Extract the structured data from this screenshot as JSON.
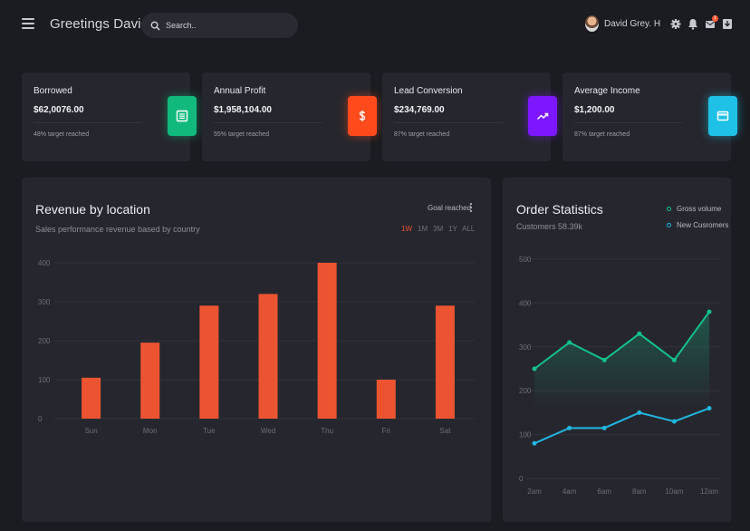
{
  "topbar": {
    "greeting": "Greetings David!",
    "search_placeholder": "Search..",
    "user_name": "David Grey. H",
    "notification_count": "1",
    "icons": [
      "menu-icon",
      "search-icon",
      "gear-icon",
      "bell-icon",
      "mail-icon",
      "download-icon"
    ]
  },
  "cards": [
    {
      "title": "Borrowed",
      "value": "$62,0076.00",
      "sub": "48% target reached",
      "color": "#12b97c",
      "icon": "list-icon"
    },
    {
      "title": "Annual Profit",
      "value": "$1,958,104.00",
      "sub": "55% target reached",
      "color": "#ff4a1c",
      "icon": "dollar-icon"
    },
    {
      "title": "Lead Conversion",
      "value": "$234,769.00",
      "sub": "87% target reached",
      "color": "#7c17ff",
      "icon": "trending-up-icon"
    },
    {
      "title": "Average Income",
      "value": "$1,200.00",
      "sub": "87% target reached",
      "color": "#1fc2e6",
      "icon": "card-icon"
    }
  ],
  "revenue": {
    "title": "Revenue by location",
    "subtitle": "Sales performance revenue based by country",
    "goal_label": "Goal reached",
    "ranges": [
      "1W",
      "1M",
      "3M",
      "1Y",
      "ALL"
    ],
    "active_range": "1W"
  },
  "orders": {
    "title": "Order Statistics",
    "subtitle": "Customers 58.39k"
  },
  "chart_data": [
    {
      "type": "bar",
      "categories": [
        "Sun",
        "Mon",
        "Tue",
        "Wed",
        "Thu",
        "Fri",
        "Sat"
      ],
      "values": [
        105,
        195,
        290,
        320,
        400,
        100,
        290
      ],
      "title": "Revenue by location",
      "ylim": [
        0,
        400
      ],
      "yticks": [
        0,
        100,
        200,
        300,
        400
      ],
      "grid": true,
      "color": "#ec5431"
    },
    {
      "type": "line",
      "title": "Order Statistics",
      "x": [
        "2am",
        "4am",
        "6am",
        "8am",
        "10am",
        "12am"
      ],
      "x_points": [
        0,
        1,
        2,
        3,
        4,
        5,
        6,
        7,
        8,
        9,
        10,
        11
      ],
      "ylim": [
        0,
        500
      ],
      "yticks": [
        0,
        100,
        200,
        300,
        400,
        500
      ],
      "grid": true,
      "legend_position": "top-right",
      "series": [
        {
          "name": "Gross volume",
          "color": "#13c28b",
          "values": [
            250,
            310,
            270,
            330,
            270,
            380
          ],
          "area": true
        },
        {
          "name": "New Cusromers",
          "color": "#20b6e0",
          "values": [
            80,
            115,
            115,
            150,
            130,
            160
          ],
          "area": false
        }
      ]
    }
  ]
}
